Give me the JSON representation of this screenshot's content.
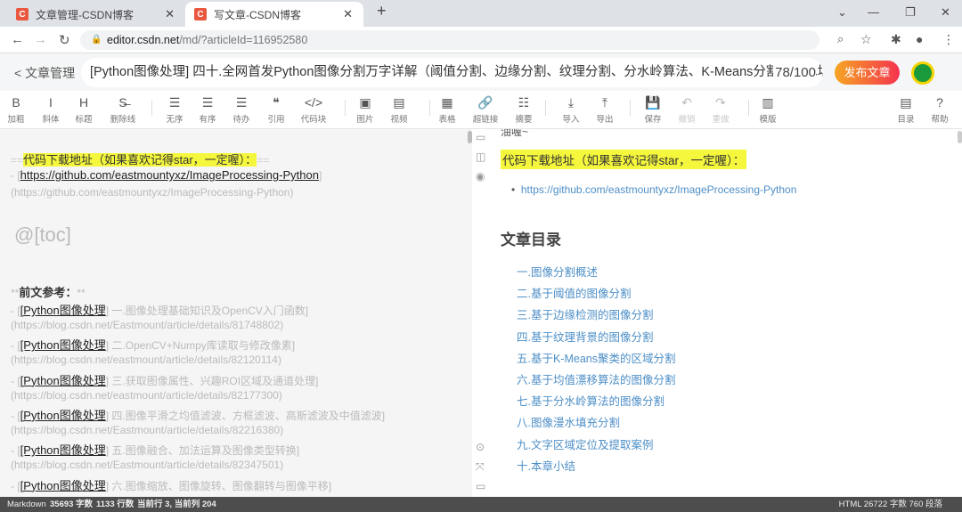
{
  "browser": {
    "tabs": [
      {
        "title": "文章管理-CSDN博客",
        "favicon": "C"
      },
      {
        "title": "写文章-CSDN博客",
        "favicon": "C"
      }
    ],
    "new_tab": "+",
    "url_host": "editor.csdn.net",
    "url_path": "/md/?articleId=116952580"
  },
  "header": {
    "back_label": "< 文章管理",
    "title": "[Python图像处理] 四十.全网首发Python图像分割万字详解（阈值分割、边缘分割、纹理分割、分水岭算法、K-Means分割、漫水填充分割、区域定位）",
    "char_count": "78/100",
    "publish_label": "发布文章"
  },
  "toolbar": [
    {
      "icon": "B",
      "label": "加粗"
    },
    {
      "icon": "I",
      "label": "斜体"
    },
    {
      "icon": "H",
      "label": "标题"
    },
    {
      "icon": "S̶",
      "label": "删除线"
    },
    {
      "icon": "☰",
      "label": "无序"
    },
    {
      "icon": "☰",
      "label": "有序"
    },
    {
      "icon": "☰",
      "label": "待办"
    },
    {
      "icon": "❝",
      "label": "引用"
    },
    {
      "icon": "</>",
      "label": "代码块"
    },
    {
      "icon": "▣",
      "label": "图片"
    },
    {
      "icon": "▤",
      "label": "视频"
    },
    {
      "icon": "▦",
      "label": "表格"
    },
    {
      "icon": "🔗",
      "label": "超链接"
    },
    {
      "icon": "☷",
      "label": "摘要"
    },
    {
      "icon": "⤓",
      "label": "导入"
    },
    {
      "icon": "⤒",
      "label": "导出"
    },
    {
      "icon": "💾",
      "label": "保存"
    },
    {
      "icon": "↶",
      "label": "撤销"
    },
    {
      "icon": "↷",
      "label": "重做"
    },
    {
      "icon": "▥",
      "label": "模版"
    },
    {
      "icon": "▤",
      "label": "目录"
    },
    {
      "icon": "?",
      "label": "帮助"
    }
  ],
  "editor": {
    "code_heading": "代码下载地址（如果喜欢记得star，一定喔）：",
    "github_link": "https://github.com/eastmountyxz/ImageProcessing-Python",
    "github_url": "(https://github.com/eastmountyxz/ImageProcessing-Python)",
    "toc": "@[toc]",
    "ref_heading": "前文参考：",
    "refs": [
      {
        "tag": "[Python图像处理",
        "title": "] 一.图像处理基础知识及OpenCV入门函数]",
        "url": "(https://blog.csdn.net/Eastmount/article/details/81748802)"
      },
      {
        "tag": "[Python图像处理",
        "title": "] 二.OpenCV+Numpy库读取与修改像素]",
        "url": "(https://blog.csdn.net/eastmount/article/details/82120114)"
      },
      {
        "tag": "[Python图像处理",
        "title": "] 三.获取图像属性、兴趣ROI区域及通道处理]",
        "url": "(https://blog.csdn.net/eastmount/article/details/82177300)"
      },
      {
        "tag": "[Python图像处理",
        "title": "] 四.图像平滑之均值滤波、方框滤波、高斯滤波及中值滤波]",
        "url": "(https://blog.csdn.net/Eastmount/article/details/82216380)"
      },
      {
        "tag": "[Python图像处理",
        "title": "] 五.图像融合、加法运算及图像类型转换]",
        "url": "(https://blog.csdn.net/Eastmount/article/details/82347501)"
      },
      {
        "tag": "[Python图像处理",
        "title": "] 六.图像缩放、图像旋转、图像翻转与图像平移]",
        "url": ""
      }
    ]
  },
  "preview": {
    "partial_top": "油喔~",
    "code_heading": "代码下载地址（如果喜欢记得star，一定喔）：",
    "github_link": "https://github.com/eastmountyxz/ImageProcessing-Python",
    "toc_title": "文章目录",
    "toc_items": [
      "一.图像分割概述",
      "二.基于阈值的图像分割",
      "三.基于边缘检测的图像分割",
      "四.基于纹理背景的图像分割",
      "五.基于K-Means聚类的区域分割",
      "六.基于均值漂移算法的图像分割",
      "七.基于分水岭算法的图像分割",
      "八.图像漫水填充分割",
      "九.文字区域定位及提取案例",
      "十.本章小结"
    ]
  },
  "status": {
    "mode": "Markdown",
    "chars": "35693 字数",
    "lines": "1133 行数",
    "cursor": "当前行 3, 当前列 204",
    "right": "HTML 26722 字数 760 段落"
  },
  "colors": {
    "highlight": "#f5f73d",
    "link": "#4e8fc7",
    "publish_start": "#f5a623",
    "publish_end": "#f5334f"
  }
}
